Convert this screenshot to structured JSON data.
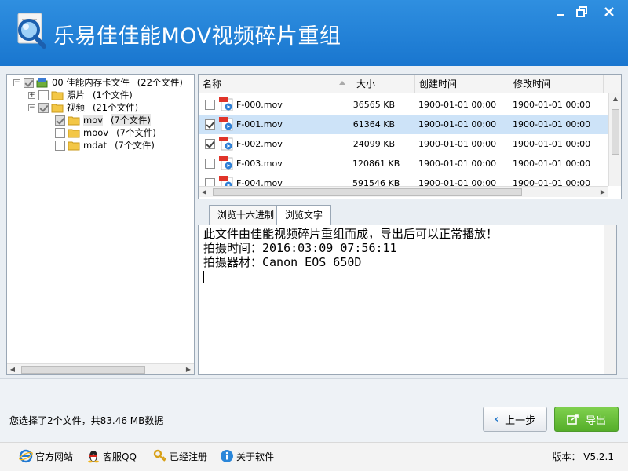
{
  "window": {
    "title": "乐易佳佳能MOV视频碎片重组",
    "controls": [
      "minimize",
      "maximize",
      "close"
    ]
  },
  "tree": {
    "items": [
      {
        "label": "00  佳能内存卡文件",
        "count": "(22个文件)",
        "checkbox": "partial",
        "expander": "−"
      },
      {
        "label": "照片",
        "count": "(1个文件)",
        "checkbox": "unchecked",
        "expander": "+"
      },
      {
        "label": "视频",
        "count": "(21个文件)",
        "checkbox": "partial",
        "expander": "−"
      },
      {
        "label": "mov",
        "count": "(7个文件)",
        "checkbox": "partial"
      },
      {
        "label": "moov",
        "count": "(7个文件)",
        "checkbox": "unchecked"
      },
      {
        "label": "mdat",
        "count": "(7个文件)",
        "checkbox": "unchecked"
      }
    ]
  },
  "file_list": {
    "columns": [
      "名称",
      "大小",
      "创建时间",
      "修改时间"
    ],
    "rows": [
      {
        "name": "F-000.mov",
        "size": "36565 KB",
        "created": "1900-01-01  00:00",
        "modified": "1900-01-01  00:00",
        "checked": false,
        "selected": false
      },
      {
        "name": "F-001.mov",
        "size": "61364 KB",
        "created": "1900-01-01  00:00",
        "modified": "1900-01-01  00:00",
        "checked": true,
        "selected": true
      },
      {
        "name": "F-002.mov",
        "size": "24099 KB",
        "created": "1900-01-01  00:00",
        "modified": "1900-01-01  00:00",
        "checked": true,
        "selected": false
      },
      {
        "name": "F-003.mov",
        "size": "120861 KB",
        "created": "1900-01-01  00:00",
        "modified": "1900-01-01  00:00",
        "checked": false,
        "selected": false
      },
      {
        "name": "F-004.mov",
        "size": "591546 KB",
        "created": "1900-01-01  00:00",
        "modified": "1900-01-01  00:00",
        "checked": false,
        "selected": false
      }
    ]
  },
  "tabs": {
    "hex": "浏览十六进制",
    "text": "浏览文字",
    "active": "text"
  },
  "viewer": {
    "lines": [
      "此文件由佳能视频碎片重组而成，导出后可以正常播放！",
      "拍摄时间：2016:03:09 07:56:11",
      "拍摄器材：Canon EOS 650D"
    ]
  },
  "status": {
    "text": "您选择了2个文件，共83.46 MB数据"
  },
  "buttons": {
    "back": "上一步",
    "export": "导出"
  },
  "footer": {
    "links": [
      "官方网站",
      "客服QQ",
      "已经注册",
      "关于软件"
    ],
    "version": "版本： V5.2.1"
  },
  "colors": {
    "titlebar": "#1976cf",
    "selected_row": "#cde3f8",
    "export_button": "#55ae2a"
  }
}
